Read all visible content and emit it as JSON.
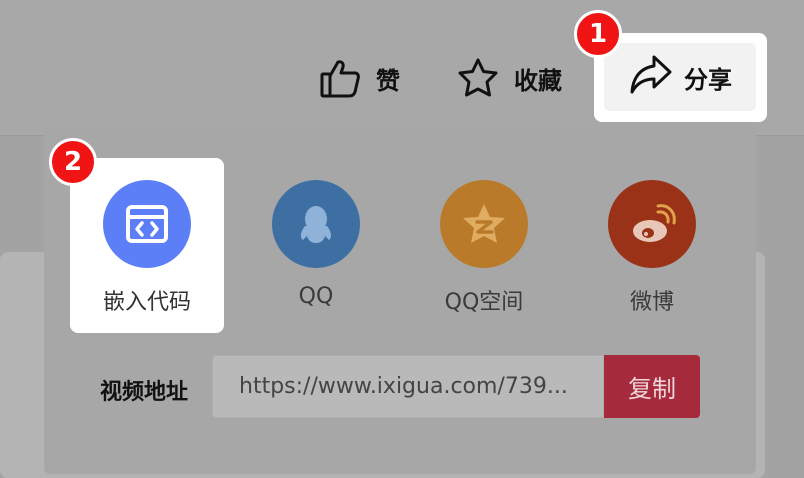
{
  "toolbar": {
    "like_label": "赞",
    "favorite_label": "收藏",
    "share_label": "分享"
  },
  "annotations": [
    "1",
    "2"
  ],
  "share_panel": {
    "options": [
      {
        "label": "嵌入代码",
        "icon": "embed-code-icon",
        "color": "#5c7ef7"
      },
      {
        "label": "QQ",
        "icon": "qq-icon",
        "color": "#3d6fa3"
      },
      {
        "label": "QQ空间",
        "icon": "qzone-icon",
        "color": "#b97a2a"
      },
      {
        "label": "微博",
        "icon": "weibo-icon",
        "color": "#9a3217"
      }
    ],
    "video_url_label": "视频地址",
    "video_url_value": "https://www.ixigua.com/739...",
    "copy_label": "复制",
    "copy_color": "#a42a3c"
  }
}
